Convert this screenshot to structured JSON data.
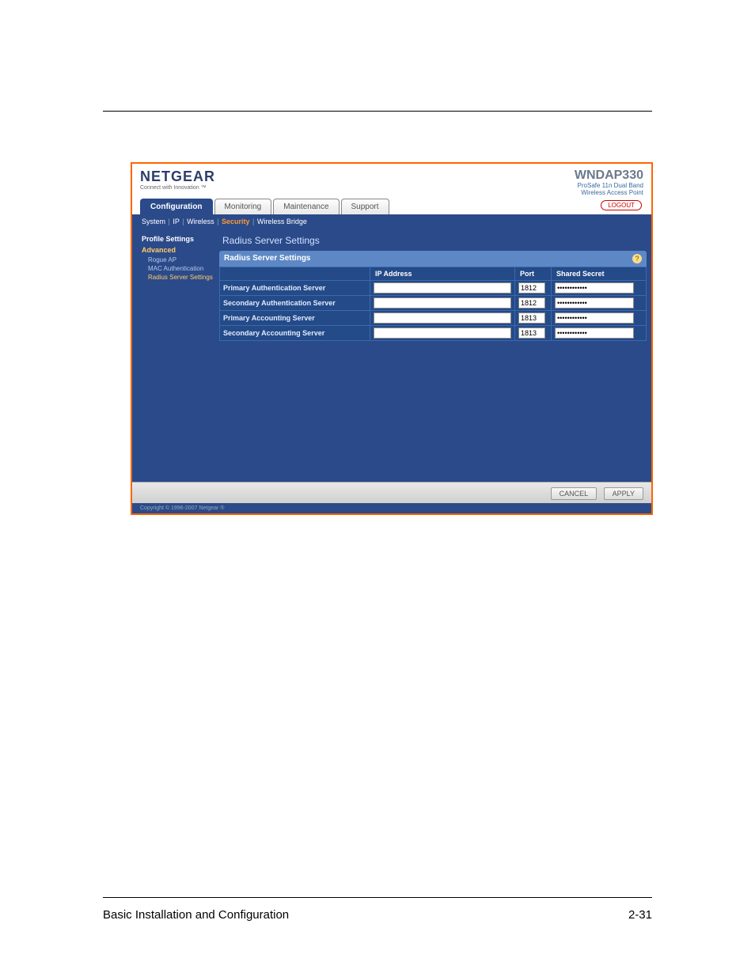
{
  "brand": {
    "name": "NETGEAR",
    "tagline": "Connect with Innovation ™",
    "model": "WNDAP330",
    "model_sub1": "ProSafe 11n Dual Band",
    "model_sub2": "Wireless Access Point"
  },
  "tabs": {
    "configuration": "Configuration",
    "monitoring": "Monitoring",
    "maintenance": "Maintenance",
    "support": "Support"
  },
  "logout_label": "LOGOUT",
  "subnav": {
    "system": "System",
    "ip": "IP",
    "wireless": "Wireless",
    "security": "Security",
    "wireless_bridge": "Wireless Bridge"
  },
  "sidebar": {
    "profile": "Profile Settings",
    "advanced": "Advanced",
    "rogue": "Rogue AP",
    "mac": "MAC Authentication",
    "radius": "Radius Server Settings"
  },
  "panel": {
    "title": "Radius Server Settings",
    "inner_title": "Radius Server Settings",
    "help_glyph": "?",
    "headers": {
      "ip": "IP Address",
      "port": "Port",
      "secret": "Shared Secret"
    },
    "rows": [
      {
        "label": "Primary Authentication Server",
        "ip": "",
        "port": "1812",
        "secret": "••••••••••••"
      },
      {
        "label": "Secondary Authentication Server",
        "ip": "",
        "port": "1812",
        "secret": "••••••••••••"
      },
      {
        "label": "Primary Accounting Server",
        "ip": "",
        "port": "1813",
        "secret": "••••••••••••"
      },
      {
        "label": "Secondary Accounting Server",
        "ip": "",
        "port": "1813",
        "secret": "••••••••••••"
      }
    ]
  },
  "buttons": {
    "cancel": "CANCEL",
    "apply": "APPLY"
  },
  "copyright": "Copyright © 1996-2007 Netgear ®",
  "footer": {
    "left": "Basic Installation and Configuration",
    "right": "2-31"
  }
}
